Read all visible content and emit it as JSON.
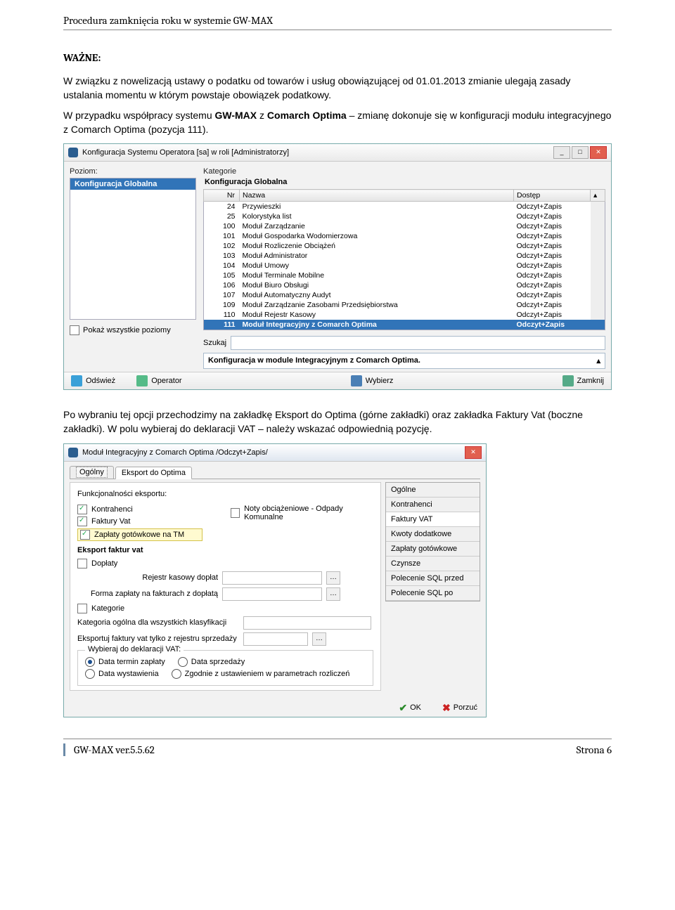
{
  "doc_header": "Procedura zamknięcia roku w systemie GW-MAX",
  "important_label": "WAŻNE:",
  "p1a": "W związku z nowelizacją ustawy o podatku od towarów i usług obowiązującej od 01.01.2013  zmianie ulegają zasady ustalania momentu w którym powstaje obowiązek podatkowy.",
  "p1b_pre": "W przypadku współpracy systemu ",
  "p1b_b1": "GW-MAX",
  "p1b_mid": " z ",
  "p1b_b2": "Comarch Optima",
  "p1b_post": " – zmianę dokonuje się w konfiguracji modułu integracyjnego z Comarch Optima (pozycja 111).",
  "win1": {
    "title": "Konfiguracja Systemu Operatora [sa] w roli [Administratorzy]",
    "level_label": "Poziom:",
    "level_selected": "Konfiguracja Globalna",
    "category_label": "Kategorie",
    "category_value": "Konfiguracja Globalna",
    "cols": {
      "nr": "Nr",
      "nazwa": "Nazwa",
      "dostep": "Dostęp"
    },
    "rows": [
      {
        "nr": "24",
        "nazwa": "Przywieszki",
        "dostep": "Odczyt+Zapis"
      },
      {
        "nr": "25",
        "nazwa": "Kolorystyka list",
        "dostep": "Odczyt+Zapis"
      },
      {
        "nr": "100",
        "nazwa": "Moduł Zarządzanie",
        "dostep": "Odczyt+Zapis"
      },
      {
        "nr": "101",
        "nazwa": "Moduł Gospodarka Wodomierzowa",
        "dostep": "Odczyt+Zapis"
      },
      {
        "nr": "102",
        "nazwa": "Moduł Rozliczenie Obciążeń",
        "dostep": "Odczyt+Zapis"
      },
      {
        "nr": "103",
        "nazwa": "Moduł Administrator",
        "dostep": "Odczyt+Zapis"
      },
      {
        "nr": "104",
        "nazwa": "Moduł Umowy",
        "dostep": "Odczyt+Zapis"
      },
      {
        "nr": "105",
        "nazwa": "Moduł Terminale Mobilne",
        "dostep": "Odczyt+Zapis"
      },
      {
        "nr": "106",
        "nazwa": "Moduł Biuro Obsługi",
        "dostep": "Odczyt+Zapis"
      },
      {
        "nr": "107",
        "nazwa": "Moduł Automatyczny Audyt",
        "dostep": "Odczyt+Zapis"
      },
      {
        "nr": "109",
        "nazwa": "Moduł Zarządzanie Zasobami Przedsiębiorstwa",
        "dostep": "Odczyt+Zapis"
      },
      {
        "nr": "110",
        "nazwa": "Moduł Rejestr Kasowy",
        "dostep": "Odczyt+Zapis"
      },
      {
        "nr": "111",
        "nazwa": "Moduł Integracyjny z Comarch Optima",
        "dostep": "Odczyt+Zapis",
        "selected": true
      }
    ],
    "search_label": "Szukaj",
    "desc_text": "Konfiguracja w module Integracyjnym z Comarch Optima.",
    "show_all_label": "Pokaż wszystkie poziomy",
    "footer": {
      "refresh": "Odśwież",
      "operator": "Operator",
      "pick": "Wybierz",
      "close": "Zamknij"
    }
  },
  "p2": "Po wybraniu tej opcji przechodzimy na zakładkę Eksport do Optima (górne zakładki) oraz zakładka Faktury Vat (boczne zakładki). W polu wybieraj do deklaracji VAT – należy wskazać odpowiednią pozycję.",
  "win2": {
    "title": "Moduł Integracyjny z Comarch Optima /Odczyt+Zapis/",
    "tabs_top": [
      "Ogólny",
      "Eksport do Optima"
    ],
    "active_top_tab": 1,
    "func_title": "Funkcjonalności eksportu:",
    "cb_kontr": "Kontrahenci",
    "cb_fakt": "Faktury Vat",
    "cb_zapg": "Zapłaty gotówkowe na TM",
    "cb_noty": "Noty obciążeniowe - Odpady Komunalne",
    "sec2_title": "Eksport faktur vat",
    "cb_dopl": "Dopłaty",
    "lbl_rejestr": "Rejestr kasowy dopłat",
    "lbl_forma": "Forma zapłaty na fakturach z dopłatą",
    "cb_kat": "Kategorie",
    "lbl_katog": "Kategoria ogólna dla wszystkich klasyfikacji",
    "lbl_eksrej": "Eksportuj faktury vat tylko z rejestru sprzedaży",
    "fs_legend": "Wybieraj do deklaracji VAT:",
    "r1": "Data termin zapłaty",
    "r2": "Data sprzedaży",
    "r3": "Data wystawienia",
    "r4": "Zgodnie z ustawieniem w parametrach rozliczeń",
    "sidetabs": [
      "Ogólne",
      "Kontrahenci",
      "Faktury VAT",
      "Kwoty dodatkowe",
      "Zapłaty gotówkowe",
      "Czynsze",
      "Polecenie SQL przed",
      "Polecenie SQL po"
    ],
    "active_side": 2,
    "ok": "OK",
    "cancel": "Porzuć"
  },
  "footer": {
    "version": "GW-MAX ver.5.5.62",
    "page": "Strona 6"
  }
}
